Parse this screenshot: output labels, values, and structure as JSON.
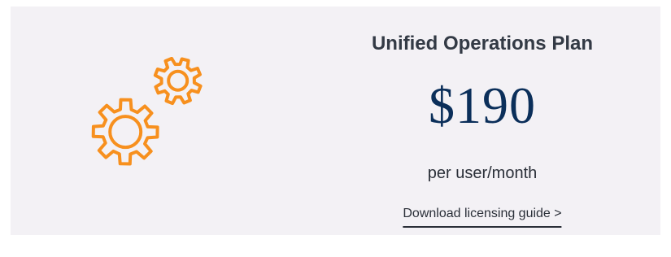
{
  "plan": {
    "title": "Unified Operations Plan",
    "price": "$190",
    "price_unit": "per user/month",
    "download_link": "Download licensing guide >"
  },
  "colors": {
    "card_background": "#f3f1f5",
    "gear_stroke": "#f7901e",
    "price_color": "#0b2f5a",
    "text_color": "#333a45"
  },
  "icons": {
    "illustration": "gears-icon"
  }
}
